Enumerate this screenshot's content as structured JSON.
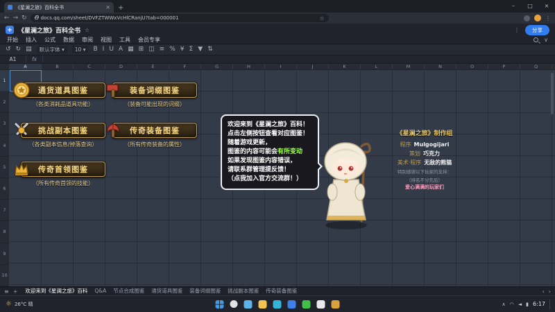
{
  "icons": {
    "close": "×",
    "minimize": "–",
    "maximize": "□",
    "plus": "+",
    "back": "←",
    "forward": "→",
    "refresh": "↻",
    "star": "☆",
    "menu": "≡",
    "dots": "⋮",
    "caret": "∨",
    "tab_prev": "‹",
    "tab_next": "›",
    "weather": "☼"
  },
  "browser": {
    "tab_title": "《星澜之旅》百科全书",
    "url": "docs.qq.com/sheet/DVFZTWWxVcHlCRanjU?tab=000001"
  },
  "doc": {
    "title": "《星澜之旅》百科全书",
    "share_label": "分享",
    "menus": [
      "开始",
      "插入",
      "公式",
      "数据",
      "审阅",
      "视图",
      "工具",
      "会员专享"
    ]
  },
  "toolbar": {
    "icons": [
      {
        "name": "undo-icon",
        "glyph": "↺"
      },
      {
        "name": "redo-icon",
        "glyph": "↻"
      },
      {
        "name": "format-painter-icon",
        "glyph": "▤"
      },
      {
        "name": "font-select",
        "glyph": "默认字体 ▾",
        "wide": true
      },
      {
        "name": "font-size-select",
        "glyph": "10 ▾",
        "wide": true
      },
      {
        "name": "bold-icon",
        "glyph": "B"
      },
      {
        "name": "italic-icon",
        "glyph": "I"
      },
      {
        "name": "underline-icon",
        "glyph": "U"
      },
      {
        "name": "text-color-icon",
        "glyph": "A"
      },
      {
        "name": "fill-color-icon",
        "glyph": "▦"
      },
      {
        "name": "borders-icon",
        "glyph": "⊞"
      },
      {
        "name": "merge-cells-icon",
        "glyph": "◫"
      },
      {
        "name": "align-icon",
        "glyph": "≡"
      },
      {
        "name": "percent-icon",
        "glyph": "%"
      },
      {
        "name": "currency-icon",
        "glyph": "¥"
      },
      {
        "name": "sum-icon",
        "glyph": "Σ"
      },
      {
        "name": "filter-icon",
        "glyph": "▼"
      },
      {
        "name": "sort-icon",
        "glyph": "⇅"
      }
    ]
  },
  "formula_bar": {
    "cell_ref": "A1",
    "fx_label": "fx"
  },
  "grid": {
    "columns": [
      "A",
      "B",
      "C",
      "D",
      "E",
      "F",
      "G",
      "H",
      "I",
      "J",
      "K",
      "L",
      "M",
      "N",
      "O",
      "P",
      "Q"
    ],
    "rows": [
      "1",
      "2",
      "3",
      "4",
      "5",
      "6",
      "7",
      "8",
      "9",
      "10"
    ]
  },
  "content": {
    "buttons": [
      {
        "label": "通货道具图鉴",
        "subtitle": "（各类消耗品道具功能）"
      },
      {
        "label": "装备词缀图鉴",
        "subtitle": "（装备可能出现的词缀）"
      },
      {
        "label": "挑战副本图鉴",
        "subtitle": "（各类副本信息/掉落查询）"
      },
      {
        "label": "传奇装备图鉴",
        "subtitle": "（所有传奇装备的属性）"
      },
      {
        "label": "传奇首领图鉴",
        "subtitle": "（所有传奇首领的技能）"
      }
    ],
    "speech": {
      "line1": "欢迎来到《星澜之旅》百科！",
      "line2": "点击左侧按钮查看对应图鉴！",
      "line3": "随着游戏更新，",
      "line4_pre": "图鉴的内容可能会",
      "line4_highlight": "有所变动",
      "line5": "如果发现图鉴内容错误，",
      "line6": "请联系群管理提反馈！",
      "line7": "（点我加入官方交流群！）",
      "highlight_color": "#9dff4f"
    },
    "credits": {
      "title": "《星澜之旅》制作组",
      "entries": [
        {
          "role": "程序",
          "name": "Mulgogijari"
        },
        {
          "role": "策划",
          "name": "巧克力"
        },
        {
          "role": "美术·程序",
          "name": "无敌的熊猫"
        }
      ],
      "thanks_line1": "特别感谢以下玩家的支持：",
      "thanks_line2": "（排名不分先后）",
      "supporter": "爱心满满的玩家们"
    }
  },
  "sheet_tabs": [
    "欢迎来到《星澜之旅》百科",
    "Q&A",
    "节点合成图鉴",
    "通货道具图鉴",
    "装备词缀图鉴",
    "挑战副本图鉴",
    "传奇装备图鉴"
  ],
  "taskbar": {
    "weather": "26°C 晴",
    "icons": [
      {
        "name": "start",
        "color": "#3f9ceb"
      },
      {
        "name": "search",
        "color": "#dfe3e8"
      },
      {
        "name": "task-view",
        "color": "#5fb2e8"
      },
      {
        "name": "file-explorer",
        "color": "#f2c14e"
      },
      {
        "name": "edge",
        "color": "#35b3d9"
      },
      {
        "name": "tencent-docs",
        "color": "#3f7fe8"
      },
      {
        "name": "wechat",
        "color": "#42c04a"
      },
      {
        "name": "qq-app",
        "color": "#e8eaee"
      },
      {
        "name": "game-app",
        "color": "#d8a23c"
      }
    ],
    "tray": [
      "∧",
      "◠",
      "◄",
      "▮"
    ],
    "time": "6:17"
  }
}
